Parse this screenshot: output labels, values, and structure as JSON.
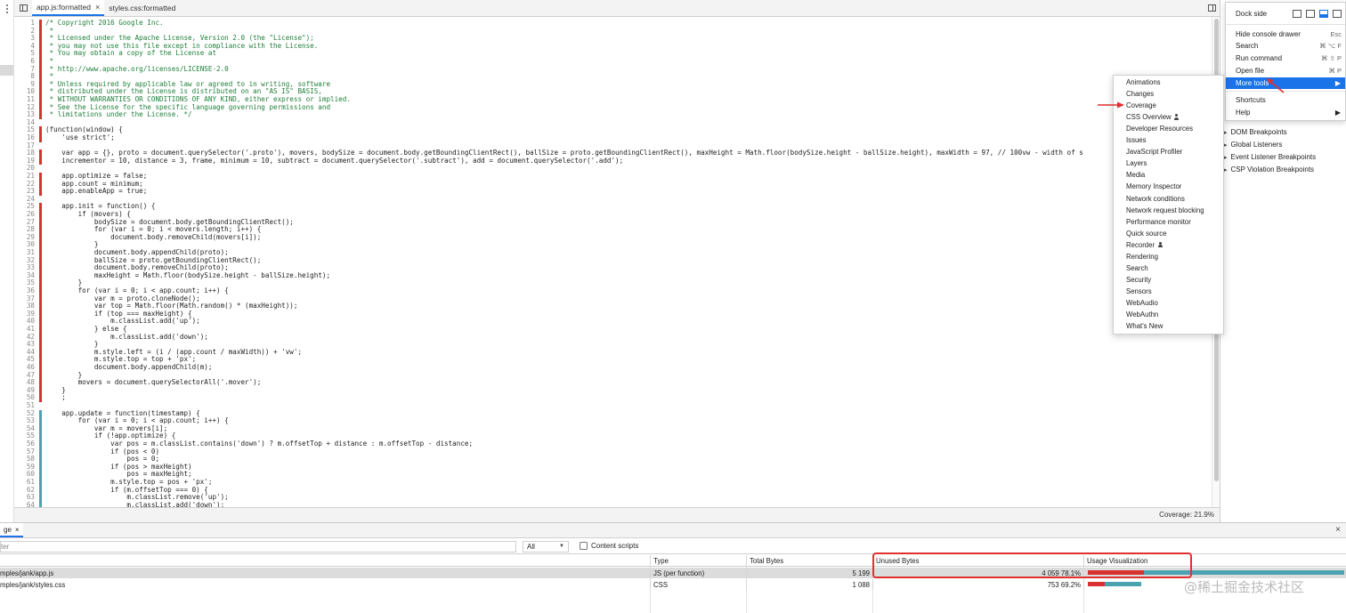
{
  "tabs": [
    {
      "label": "app.js:formatted",
      "active": true
    },
    {
      "label": "styles.css:formatted",
      "active": false
    }
  ],
  "code_lines": [
    {
      "n": "1",
      "t": "/* Copyright 2016 Google Inc.",
      "c": "red",
      "comment": true
    },
    {
      "n": "2",
      "t": " *",
      "c": "red",
      "comment": true
    },
    {
      "n": "3",
      "t": " * Licensed under the Apache License, Version 2.0 (the \"License\");",
      "c": "red",
      "comment": true
    },
    {
      "n": "4",
      "t": " * you may not use this file except in compliance with the License.",
      "c": "red",
      "comment": true
    },
    {
      "n": "5",
      "t": " * You may obtain a copy of the License at",
      "c": "red",
      "comment": true
    },
    {
      "n": "6",
      "t": " *",
      "c": "red",
      "comment": true
    },
    {
      "n": "7",
      "t": " * http://www.apache.org/licenses/LICENSE-2.0",
      "c": "red",
      "comment": true
    },
    {
      "n": "8",
      "t": " *",
      "c": "red",
      "comment": true
    },
    {
      "n": "9",
      "t": " * Unless required by applicable law or agreed to in writing, software",
      "c": "red",
      "comment": true
    },
    {
      "n": "10",
      "t": " * distributed under the License is distributed on an \"AS IS\" BASIS,",
      "c": "red",
      "comment": true
    },
    {
      "n": "11",
      "t": " * WITHOUT WARRANTIES OR CONDITIONS OF ANY KIND, either express or implied.",
      "c": "red",
      "comment": true
    },
    {
      "n": "12",
      "t": " * See the License for the specific language governing permissions and",
      "c": "red",
      "comment": true
    },
    {
      "n": "13",
      "t": " * limitations under the License. */",
      "c": "red",
      "comment": true
    },
    {
      "n": "14",
      "t": "",
      "c": "",
      "comment": false
    },
    {
      "n": "15",
      "t": "(function(window) {",
      "c": "red",
      "comment": false
    },
    {
      "n": "16",
      "t": "    'use strict';",
      "c": "red",
      "comment": false
    },
    {
      "n": "17",
      "t": "",
      "c": "",
      "comment": false
    },
    {
      "n": "18",
      "t": "    var app = {}, proto = document.querySelector('.proto'), movers, bodySize = document.body.getBoundingClientRect(), ballSize = proto.getBoundingClientRect(), maxHeight = Math.floor(bodySize.height - ballSize.height), maxWidth = 97, // 100vw - width of s",
      "c": "red",
      "comment": false
    },
    {
      "n": "19",
      "t": "    incrementor = 10, distance = 3, frame, minimum = 10, subtract = document.querySelector('.subtract'), add = document.querySelector('.add');",
      "c": "red",
      "comment": false
    },
    {
      "n": "20",
      "t": "",
      "c": "",
      "comment": false
    },
    {
      "n": "21",
      "t": "    app.optimize = false;",
      "c": "red",
      "comment": false
    },
    {
      "n": "22",
      "t": "    app.count = minimum;",
      "c": "red",
      "comment": false
    },
    {
      "n": "23",
      "t": "    app.enableApp = true;",
      "c": "red",
      "comment": false
    },
    {
      "n": "24",
      "t": "",
      "c": "",
      "comment": false
    },
    {
      "n": "25",
      "t": "    app.init = function() {",
      "c": "red",
      "comment": false
    },
    {
      "n": "26",
      "t": "        if (movers) {",
      "c": "red",
      "comment": false
    },
    {
      "n": "27",
      "t": "            bodySize = document.body.getBoundingClientRect();",
      "c": "red",
      "comment": false
    },
    {
      "n": "28",
      "t": "            for (var i = 0; i < movers.length; i++) {",
      "c": "red",
      "comment": false
    },
    {
      "n": "29",
      "t": "                document.body.removeChild(movers[i]);",
      "c": "red",
      "comment": false
    },
    {
      "n": "30",
      "t": "            }",
      "c": "red",
      "comment": false
    },
    {
      "n": "31",
      "t": "            document.body.appendChild(proto);",
      "c": "red",
      "comment": false
    },
    {
      "n": "32",
      "t": "            ballSize = proto.getBoundingClientRect();",
      "c": "red",
      "comment": false
    },
    {
      "n": "33",
      "t": "            document.body.removeChild(proto);",
      "c": "red",
      "comment": false
    },
    {
      "n": "34",
      "t": "            maxHeight = Math.floor(bodySize.height - ballSize.height);",
      "c": "red",
      "comment": false
    },
    {
      "n": "35",
      "t": "        }",
      "c": "red",
      "comment": false
    },
    {
      "n": "36",
      "t": "        for (var i = 0; i < app.count; i++) {",
      "c": "red",
      "comment": false
    },
    {
      "n": "37",
      "t": "            var m = proto.cloneNode();",
      "c": "red",
      "comment": false
    },
    {
      "n": "38",
      "t": "            var top = Math.floor(Math.random() * (maxHeight));",
      "c": "red",
      "comment": false
    },
    {
      "n": "39",
      "t": "            if (top === maxHeight) {",
      "c": "red",
      "comment": false
    },
    {
      "n": "40",
      "t": "                m.classList.add('up');",
      "c": "red",
      "comment": false
    },
    {
      "n": "41",
      "t": "            } else {",
      "c": "red",
      "comment": false
    },
    {
      "n": "42",
      "t": "                m.classList.add('down');",
      "c": "red",
      "comment": false
    },
    {
      "n": "43",
      "t": "            }",
      "c": "red",
      "comment": false
    },
    {
      "n": "44",
      "t": "            m.style.left = (i / (app.count / maxWidth)) + 'vw';",
      "c": "red",
      "comment": false
    },
    {
      "n": "45",
      "t": "            m.style.top = top + 'px';",
      "c": "red",
      "comment": false
    },
    {
      "n": "46",
      "t": "            document.body.appendChild(m);",
      "c": "red",
      "comment": false
    },
    {
      "n": "47",
      "t": "        }",
      "c": "red",
      "comment": false
    },
    {
      "n": "48",
      "t": "        movers = document.querySelectorAll('.mover');",
      "c": "red",
      "comment": false
    },
    {
      "n": "49",
      "t": "    }",
      "c": "red",
      "comment": false
    },
    {
      "n": "50",
      "t": "    ;",
      "c": "red",
      "comment": false
    },
    {
      "n": "51",
      "t": "",
      "c": "",
      "comment": false
    },
    {
      "n": "52",
      "t": "    app.update = function(timestamp) {",
      "c": "teal",
      "comment": false
    },
    {
      "n": "53",
      "t": "        for (var i = 0; i < app.count; i++) {",
      "c": "teal",
      "comment": false
    },
    {
      "n": "54",
      "t": "            var m = movers[i];",
      "c": "teal",
      "comment": false
    },
    {
      "n": "55",
      "t": "            if (!app.optimize) {",
      "c": "teal",
      "comment": false
    },
    {
      "n": "56",
      "t": "                var pos = m.classList.contains('down') ? m.offsetTop + distance : m.offsetTop - distance;",
      "c": "teal",
      "comment": false
    },
    {
      "n": "57",
      "t": "                if (pos < 0)",
      "c": "teal",
      "comment": false
    },
    {
      "n": "58",
      "t": "                    pos = 0;",
      "c": "teal",
      "comment": false
    },
    {
      "n": "59",
      "t": "                if (pos > maxHeight)",
      "c": "teal",
      "comment": false
    },
    {
      "n": "60",
      "t": "                    pos = maxHeight;",
      "c": "teal",
      "comment": false
    },
    {
      "n": "61",
      "t": "                m.style.top = pos + 'px';",
      "c": "teal",
      "comment": false
    },
    {
      "n": "62",
      "t": "                if (m.offsetTop === 0) {",
      "c": "teal",
      "comment": false
    },
    {
      "n": "63",
      "t": "                    m.classList.remove('up');",
      "c": "teal",
      "comment": false
    },
    {
      "n": "64",
      "t": "                    m.classList.add('down');",
      "c": "teal",
      "comment": false
    }
  ],
  "status": {
    "coverage": "Coverage: 21.9%"
  },
  "sidebar": {
    "items": [
      "DOM Breakpoints",
      "Global Listeners",
      "Event Listener Breakpoints",
      "CSP Violation Breakpoints"
    ]
  },
  "main_menu": {
    "dock_label": "Dock side",
    "items": [
      {
        "label": "Hide console drawer",
        "shortcut": "Esc"
      },
      {
        "label": "Search",
        "shortcut": "⌘ ⌥ F"
      },
      {
        "label": "Run command",
        "shortcut": "⌘ ⇧ P"
      },
      {
        "label": "Open file",
        "shortcut": "⌘ P"
      },
      {
        "label": "More tools",
        "shortcut": ""
      },
      {
        "label": "Shortcuts",
        "shortcut": ""
      },
      {
        "label": "Help",
        "shortcut": ""
      }
    ]
  },
  "more_tools": [
    {
      "label": "Animations",
      "person": false
    },
    {
      "label": "Changes",
      "person": false
    },
    {
      "label": "Coverage",
      "person": false
    },
    {
      "label": "CSS Overview",
      "person": true
    },
    {
      "label": "Developer Resources",
      "person": false
    },
    {
      "label": "Issues",
      "person": false
    },
    {
      "label": "JavaScript Profiler",
      "person": false
    },
    {
      "label": "Layers",
      "person": false
    },
    {
      "label": "Media",
      "person": false
    },
    {
      "label": "Memory Inspector",
      "person": false
    },
    {
      "label": "Network conditions",
      "person": false
    },
    {
      "label": "Network request blocking",
      "person": false
    },
    {
      "label": "Performance monitor",
      "person": false
    },
    {
      "label": "Quick source",
      "person": false
    },
    {
      "label": "Recorder",
      "person": true
    },
    {
      "label": "Rendering",
      "person": false
    },
    {
      "label": "Search",
      "person": false
    },
    {
      "label": "Security",
      "person": false
    },
    {
      "label": "Sensors",
      "person": false
    },
    {
      "label": "WebAudio",
      "person": false
    },
    {
      "label": "WebAuthn",
      "person": false
    },
    {
      "label": "What's New",
      "person": false
    }
  ],
  "drawer": {
    "tab_label": "ge",
    "filter_value": "ter",
    "type_filter": "All",
    "content_scripts_label": "Content scripts",
    "columns": [
      "Type",
      "Total Bytes",
      "Unused Bytes",
      "Usage Visualization"
    ],
    "rows": [
      {
        "url": "mples/jank/app.js",
        "type": "JS (per function)",
        "total": "5 199",
        "unused": "4 059",
        "pct": "78.1%",
        "used_frac": 0.219
      },
      {
        "url": "mples/jank/styles.css",
        "type": "CSS",
        "total": "1 088",
        "unused": "753",
        "pct": "69.2%",
        "used_frac": 0.308
      }
    ]
  },
  "watermark": "@稀土掘金技术社区",
  "colors": {
    "used": "#d93030",
    "unused": "#4aa3b0",
    "accent": "#1a73e8",
    "annotation": "#e03030"
  }
}
